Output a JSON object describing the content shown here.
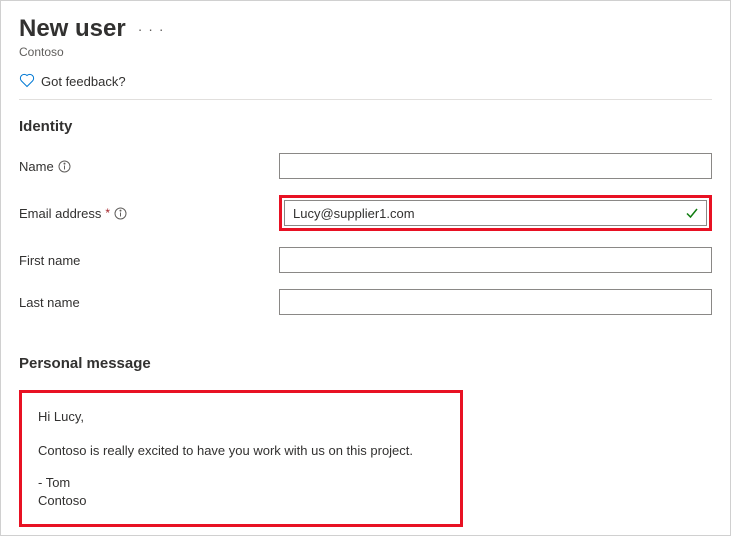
{
  "header": {
    "title": "New user",
    "subtitle": "Contoso",
    "feedback_label": "Got feedback?"
  },
  "sections": {
    "identity": {
      "heading": "Identity",
      "fields": {
        "name": {
          "label": "Name",
          "value": ""
        },
        "email": {
          "label": "Email address",
          "value": "Lucy@supplier1.com",
          "required": true
        },
        "first_name": {
          "label": "First name",
          "value": ""
        },
        "last_name": {
          "label": "Last name",
          "value": ""
        }
      }
    },
    "personal_message": {
      "heading": "Personal message",
      "greeting": "Hi Lucy,",
      "body": "Contoso is really excited to have you work with us on this project.",
      "signature_name": "- Tom",
      "signature_org": "Contoso"
    }
  },
  "colors": {
    "accent": "#0078d4",
    "highlight_border": "#e81123",
    "success": "#107c10",
    "required": "#a4262c"
  }
}
